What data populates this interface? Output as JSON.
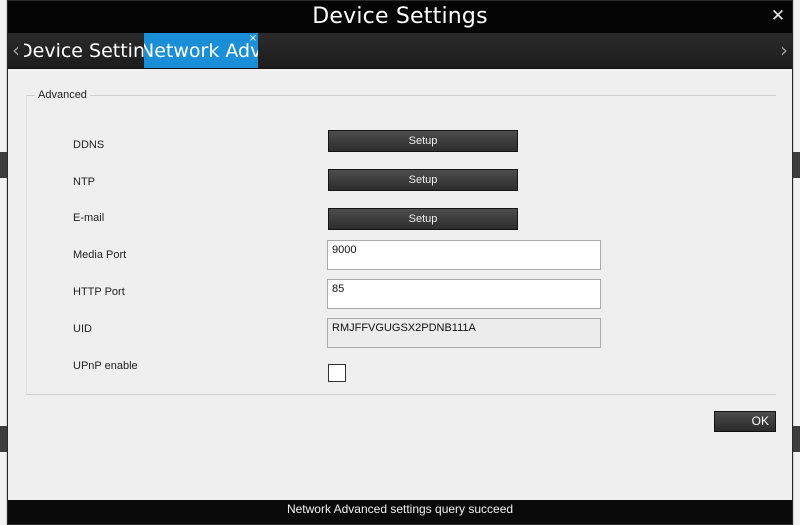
{
  "window": {
    "title": "Device Settings",
    "close_glyph": "✕"
  },
  "tabs": {
    "prev_glyph": "‹",
    "next_glyph": "›",
    "items": [
      {
        "label": "Device Settings",
        "active": false
      },
      {
        "label": "Network Advanced",
        "active": true
      }
    ],
    "close_glyph": "×"
  },
  "advanced": {
    "legend": "Advanced",
    "ddns": {
      "label": "DDNS",
      "button": "Setup"
    },
    "ntp": {
      "label": "NTP",
      "button": "Setup"
    },
    "email": {
      "label": "E-mail",
      "button": "Setup"
    },
    "media_port": {
      "label": "Media Port",
      "value": "9000"
    },
    "http_port": {
      "label": "HTTP Port",
      "value": "85"
    },
    "uid": {
      "label": "UID",
      "value": "RMJFFVGUGSX2PDNB111A"
    },
    "upnp": {
      "label": "UPnP enable",
      "checked": false
    }
  },
  "ok_button": "OK",
  "status": "Network Advanced settings query succeed",
  "colors": {
    "titlebar": "#050505",
    "active_tab": "#1a8fd8",
    "button": "#3a3a3a",
    "background": "#efefef"
  }
}
